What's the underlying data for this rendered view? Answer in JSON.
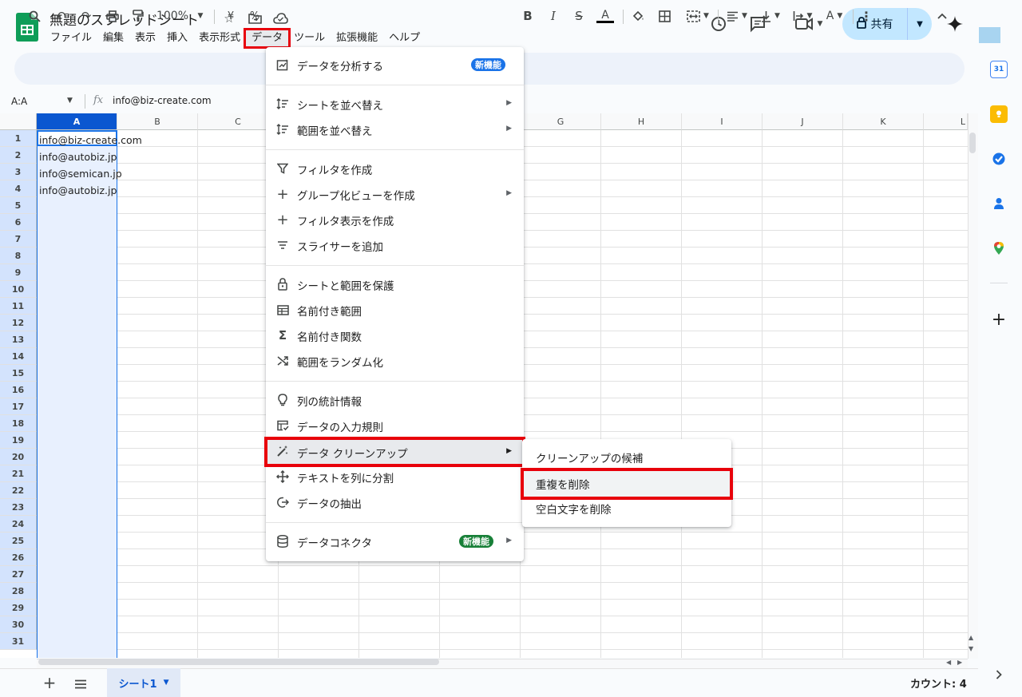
{
  "document": {
    "title": "無題のスプレッドシート"
  },
  "menubar": [
    "ファイル",
    "編集",
    "表示",
    "挿入",
    "表示形式",
    "データ",
    "ツール",
    "拡張機能",
    "ヘルプ"
  ],
  "share": {
    "label": "共有"
  },
  "toolbar": {
    "zoom": "100%",
    "currency": "¥",
    "percent": "%"
  },
  "formula_bar": {
    "name_box": "A:A",
    "fx": "fx",
    "content": "info@biz-create.com"
  },
  "columns": [
    "A",
    "B",
    "C",
    "D",
    "E",
    "F",
    "G",
    "H",
    "I",
    "J",
    "K",
    "L"
  ],
  "rows": [
    "1",
    "2",
    "3",
    "4",
    "5",
    "6",
    "7",
    "8",
    "9",
    "10",
    "11",
    "12",
    "13",
    "14",
    "15",
    "16",
    "17",
    "18",
    "19",
    "20",
    "21",
    "22",
    "23",
    "24",
    "25",
    "26",
    "27",
    "28",
    "29",
    "30",
    "31"
  ],
  "cells": [
    "info@biz-create.com",
    "info@autobiz.jp",
    "info@semican.jp",
    "info@autobiz.jp"
  ],
  "data_menu": {
    "items": [
      {
        "label": "データを分析する",
        "icon": "analyze-icon",
        "badge": "新機能",
        "badge_color": "#1a73e8"
      },
      {
        "label": "シートを並べ替え",
        "icon": "sort-icon",
        "submenu": true
      },
      {
        "label": "範囲を並べ替え",
        "icon": "sort-icon",
        "submenu": true
      },
      {
        "label": "フィルタを作成",
        "icon": "filter-icon"
      },
      {
        "label": "グループ化ビューを作成",
        "icon": "plus-icon",
        "submenu": true
      },
      {
        "label": "フィルタ表示を作成",
        "icon": "plus-icon"
      },
      {
        "label": "スライサーを追加",
        "icon": "slicer-icon"
      },
      {
        "label": "シートと範囲を保護",
        "icon": "lock-icon"
      },
      {
        "label": "名前付き範囲",
        "icon": "table-icon"
      },
      {
        "label": "名前付き関数",
        "icon": "sigma-icon"
      },
      {
        "label": "範囲をランダム化",
        "icon": "shuffle-icon"
      },
      {
        "label": "列の統計情報",
        "icon": "bulb-icon"
      },
      {
        "label": "データの入力規則",
        "icon": "validation-icon"
      },
      {
        "label": "データ クリーンアップ",
        "icon": "magic-wand-icon",
        "submenu": true
      },
      {
        "label": "テキストを列に分割",
        "icon": "split-icon"
      },
      {
        "label": "データの抽出",
        "icon": "extract-icon"
      },
      {
        "label": "データコネクタ",
        "icon": "database-icon",
        "badge": "新機能",
        "badge_color": "#188038",
        "submenu": true
      }
    ]
  },
  "cleanup_submenu": [
    "クリーンアップの候補",
    "重複を削除",
    "空白文字を削除"
  ],
  "sheet_tabs": [
    {
      "label": "シート1"
    }
  ],
  "status": {
    "count": "カウント: 4"
  },
  "colors": {
    "highlight": "#e8000b",
    "accent": "#0b57d0",
    "sheets_green": "#0f9d58"
  }
}
